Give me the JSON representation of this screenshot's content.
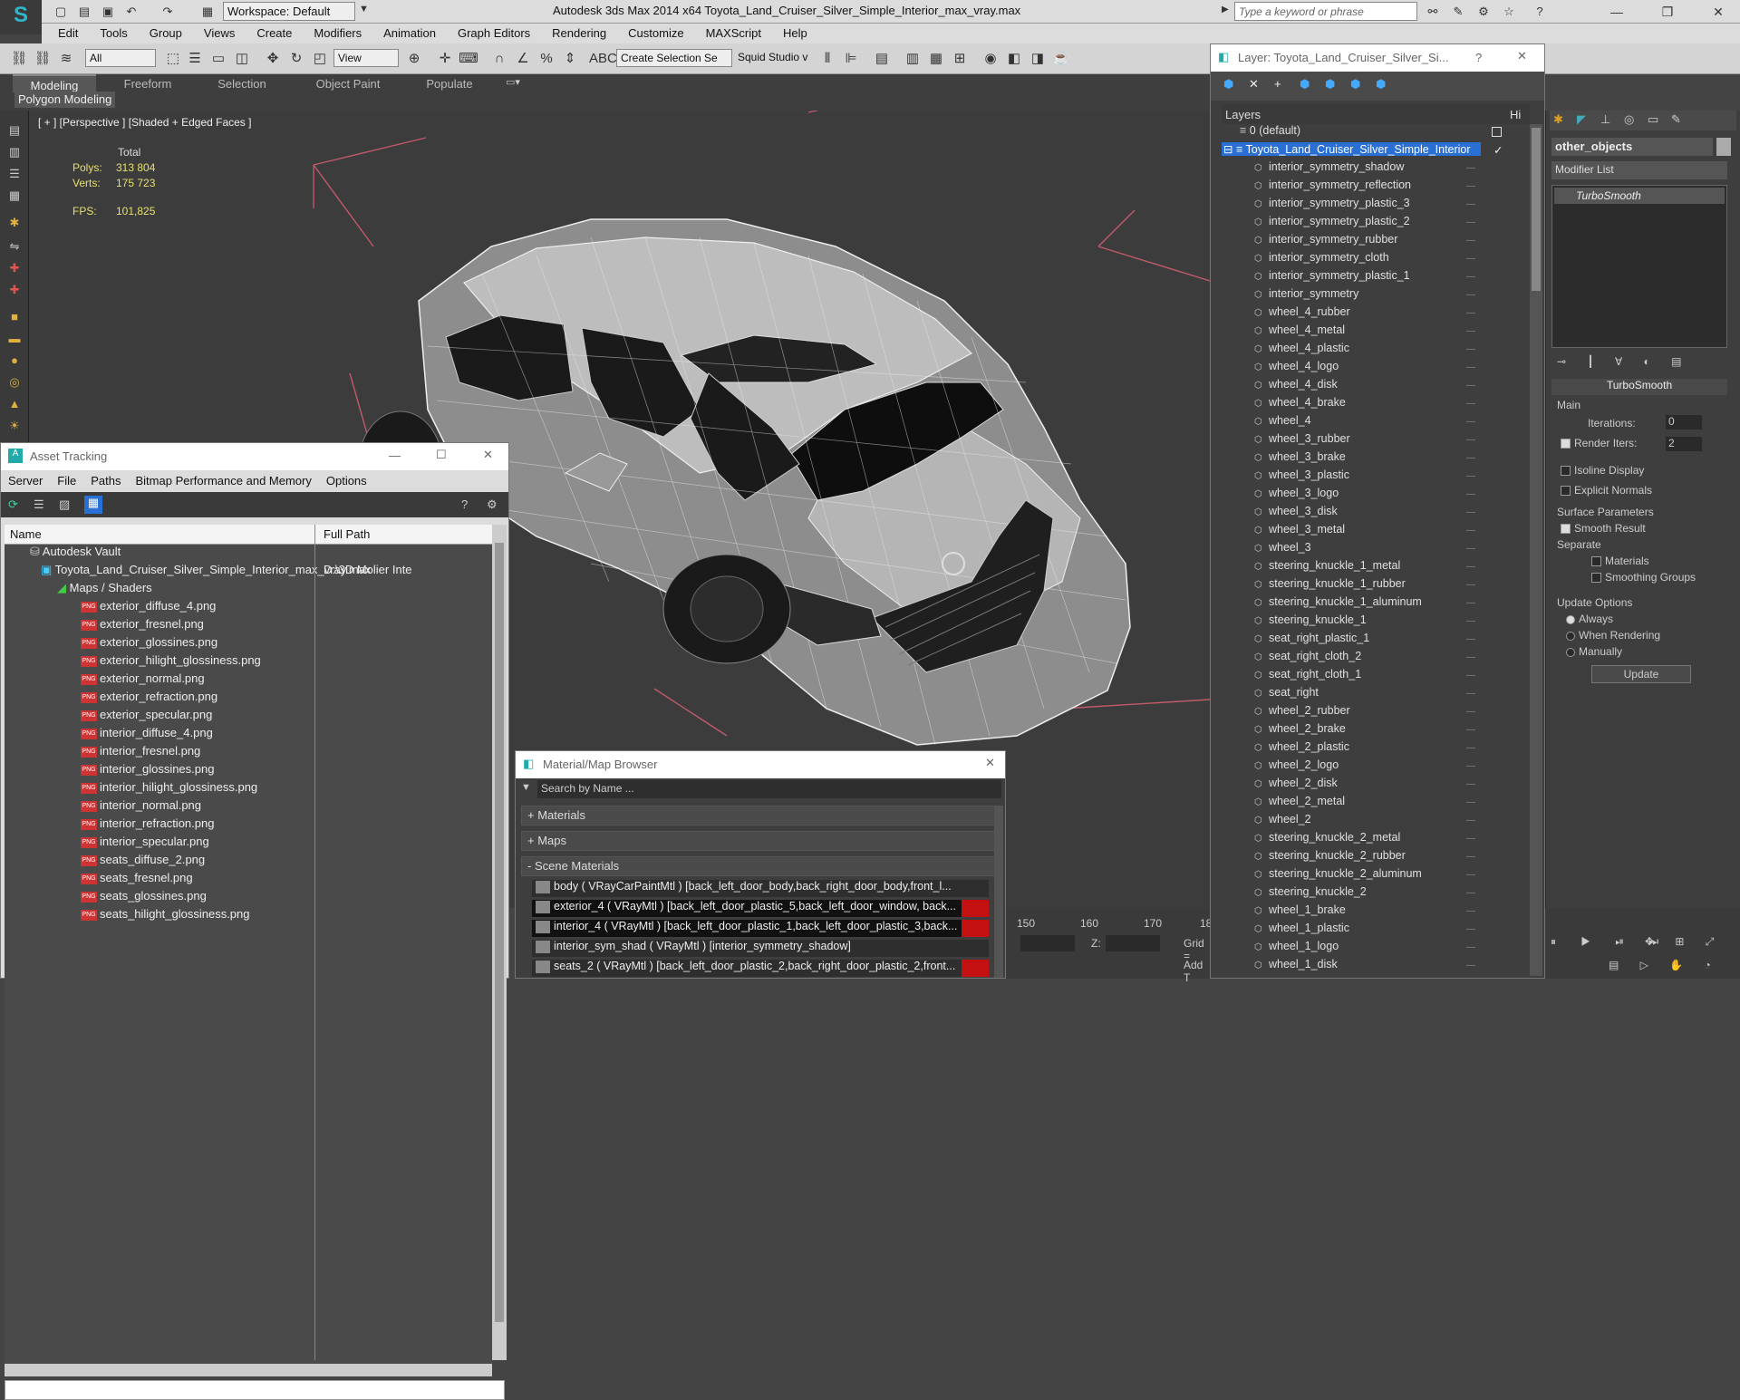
{
  "app": {
    "title": "Autodesk 3ds Max  2014 x64    Toyota_Land_Cruiser_Silver_Simple_Interior_max_vray.max",
    "workspace": "Workspace: Default",
    "search_placeholder": "Type a keyword or phrase"
  },
  "menu": [
    "Edit",
    "Tools",
    "Group",
    "Views",
    "Create",
    "Modifiers",
    "Animation",
    "Graph Editors",
    "Rendering",
    "Customize",
    "MAXScript",
    "Help"
  ],
  "toolbar": {
    "selection_filter": "All",
    "ref_coord": "View",
    "named_selection": "Create Selection Se",
    "squid": "Squid Studio v"
  },
  "ribbon": {
    "tabs": [
      "Modeling",
      "Freeform",
      "Selection",
      "Object Paint",
      "Populate"
    ],
    "sub": "Polygon Modeling"
  },
  "viewport": {
    "label": "[ + ] [Perspective ] [Shaded + Edged Faces ]",
    "stats": {
      "total_label": "Total",
      "polys_label": "Polys:",
      "polys": "313 804",
      "verts_label": "Verts:",
      "verts": "175 723",
      "fps_label": "FPS:",
      "fps": "101,825"
    }
  },
  "asset_tracking": {
    "title": "Asset Tracking",
    "menu": [
      "Server",
      "File",
      "Paths",
      "Bitmap Performance and Memory",
      "Options"
    ],
    "col_name": "Name",
    "col_path": "Full Path",
    "vault": "Autodesk Vault",
    "file": "Toyota_Land_Cruiser_Silver_Simple_Interior_max_vray.max",
    "file_path": "D:\\3D Molier Inte",
    "group": "Maps / Shaders",
    "files": [
      "exterior_diffuse_4.png",
      "exterior_fresnel.png",
      "exterior_glossines.png",
      "exterior_hilight_glossiness.png",
      "exterior_normal.png",
      "exterior_refraction.png",
      "exterior_specular.png",
      "interior_diffuse_4.png",
      "interior_fresnel.png",
      "interior_glossines.png",
      "interior_hilight_glossiness.png",
      "interior_normal.png",
      "interior_refraction.png",
      "interior_specular.png",
      "seats_diffuse_2.png",
      "seats_fresnel.png",
      "seats_glossines.png",
      "seats_hilight_glossiness.png"
    ]
  },
  "layer_dialog": {
    "title": "Layer: Toyota_Land_Cruiser_Silver_Si...",
    "help": "?",
    "col_layers": "Layers",
    "col_hide": "Hi",
    "default_layer": "0 (default)",
    "main_layer": "Toyota_Land_Cruiser_Silver_Simple_Interior",
    "items": [
      "interior_symmetry_shadow",
      "interior_symmetry_reflection",
      "interior_symmetry_plastic_3",
      "interior_symmetry_plastic_2",
      "interior_symmetry_rubber",
      "interior_symmetry_cloth",
      "interior_symmetry_plastic_1",
      "interior_symmetry",
      "wheel_4_rubber",
      "wheel_4_metal",
      "wheel_4_plastic",
      "wheel_4_logo",
      "wheel_4_disk",
      "wheel_4_brake",
      "wheel_4",
      "wheel_3_rubber",
      "wheel_3_brake",
      "wheel_3_plastic",
      "wheel_3_logo",
      "wheel_3_disk",
      "wheel_3_metal",
      "wheel_3",
      "steering_knuckle_1_metal",
      "steering_knuckle_1_rubber",
      "steering_knuckle_1_aluminum",
      "steering_knuckle_1",
      "seat_right_plastic_1",
      "seat_right_cloth_2",
      "seat_right_cloth_1",
      "seat_right",
      "wheel_2_rubber",
      "wheel_2_brake",
      "wheel_2_plastic",
      "wheel_2_logo",
      "wheel_2_disk",
      "wheel_2_metal",
      "wheel_2",
      "steering_knuckle_2_metal",
      "steering_knuckle_2_rubber",
      "steering_knuckle_2_aluminum",
      "steering_knuckle_2",
      "wheel_1_brake",
      "wheel_1_plastic",
      "wheel_1_logo",
      "wheel_1_disk"
    ]
  },
  "command_panel": {
    "object_name": "other_objects",
    "modifier_list": "Modifier List",
    "modifier": "TurboSmooth",
    "rollout": "TurboSmooth",
    "main": "Main",
    "iterations_label": "Iterations:",
    "iterations": "0",
    "render_iters_label": "Render Iters:",
    "render_iters": "2",
    "isoline": "Isoline Display",
    "explicit": "Explicit Normals",
    "surface_params": "Surface Parameters",
    "smooth_result": "Smooth Result",
    "separate": "Separate",
    "materials": "Materials",
    "smoothing_groups": "Smoothing Groups",
    "update_options": "Update Options",
    "always": "Always",
    "when_rendering": "When Rendering",
    "manually": "Manually",
    "update_btn": "Update"
  },
  "material_browser": {
    "title": "Material/Map Browser",
    "search_placeholder": "Search by Name ...",
    "sections": [
      "+ Materials",
      "+ Maps",
      "- Scene Materials"
    ],
    "rows": [
      "body ( VRayCarPaintMtl ) [back_left_door_body,back_right_door_body,front_l...",
      "exterior_4 ( VRayMtl ) [back_left_door_plastic_5,back_left_door_window, back...",
      "interior_4 ( VRayMtl ) [back_left_door_plastic_1,back_left_door_plastic_3,back...",
      "interior_sym_shad ( VRayMtl ) [interior_symmetry_shadow]",
      "seats_2 ( VRayMtl ) [back_left_door_plastic_2,back_right_door_plastic_2,front..."
    ]
  },
  "timeline": {
    "ticks": [
      "150",
      "160",
      "170",
      "18"
    ],
    "grid": "Grid =",
    "add": "Add T"
  },
  "colors": {
    "accent": "#2a6fd4",
    "selected": "#2a6fd4"
  }
}
